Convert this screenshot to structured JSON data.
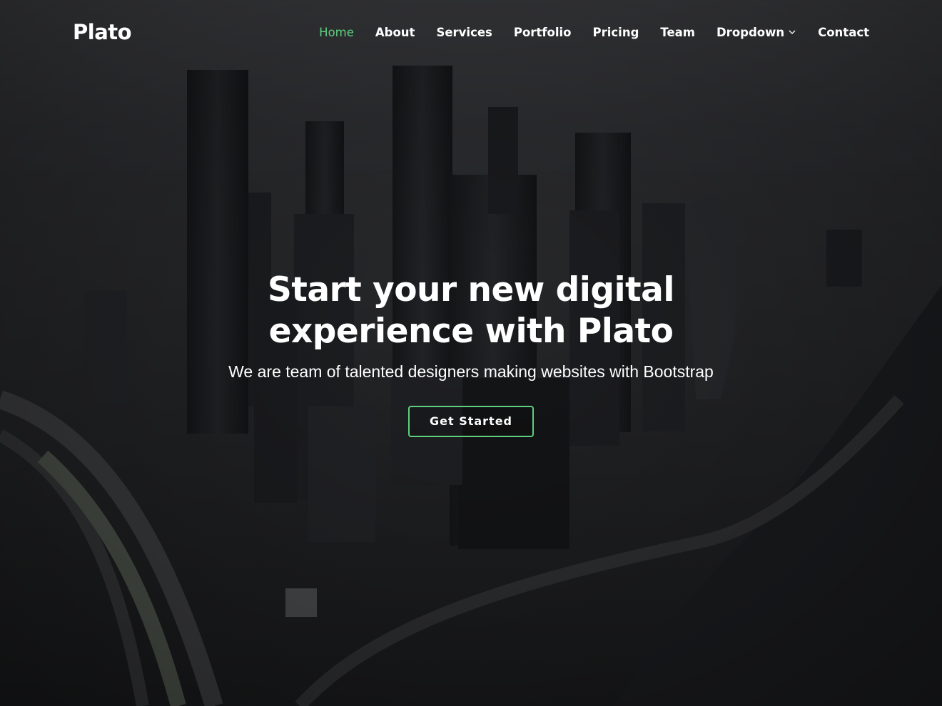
{
  "brand": {
    "name": "Plato",
    "accent_color": "#5fcf80"
  },
  "nav": {
    "items": [
      {
        "label": "Home",
        "active": true
      },
      {
        "label": "About"
      },
      {
        "label": "Services"
      },
      {
        "label": "Portfolio"
      },
      {
        "label": "Pricing"
      },
      {
        "label": "Team"
      },
      {
        "label": "Dropdown",
        "icon": "chevron-down-icon"
      },
      {
        "label": "Contact"
      }
    ]
  },
  "hero": {
    "title": "Start your new digital experience with Plato",
    "subtitle": "We are team of talented designers making websites with Bootstrap",
    "cta_label": "Get Started"
  }
}
